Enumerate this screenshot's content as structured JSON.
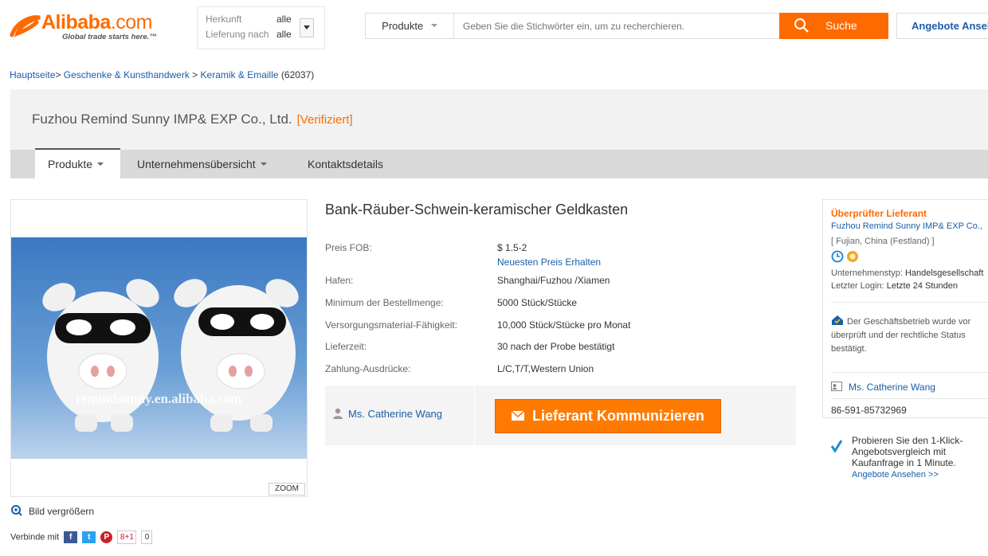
{
  "header": {
    "logo_brand": "Alibaba",
    "logo_suffix": ".com",
    "logo_tagline": "Global trade starts here.™",
    "origin_label": "Herkunft",
    "origin_value": "alle",
    "delivery_label": "Lieferung nach",
    "delivery_value": "alle",
    "search_category": "Produkte",
    "search_placeholder": "Geben Sie die Stichwörter ein, um zu recherchieren.",
    "search_button": "Suche",
    "offers_button": "Angebote Ansehen"
  },
  "breadcrumb": {
    "home": "Hauptseite",
    "sep": ">",
    "cat1": "Geschenke & Kunsthandwerk",
    "cat2": "Keramik & Emaille",
    "count": "(62037)"
  },
  "company": {
    "name": "Fuzhou Remind Sunny IMP& EXP Co., Ltd.",
    "verified": "[Verifiziert]"
  },
  "tabs": [
    {
      "label": "Produkte"
    },
    {
      "label": "Unternehmensübersicht"
    },
    {
      "label": "Kontaktsdetails"
    }
  ],
  "gallery": {
    "watermark": "remindsunny.en.alibaba.com",
    "zoom": "ZOOM",
    "enlarge": "Bild vergrößern",
    "share_label": "Verbinde mit",
    "gplus": "8+1",
    "share_count": "0"
  },
  "product": {
    "title": "Bank-Räuber-Schwein-keramischer Geldkasten",
    "price_label": "Preis FOB:",
    "price_value": "$ 1.5-2",
    "price_link": "Neuesten Preis Erhalten",
    "port_label": "Hafen:",
    "port_value": "Shanghai/Fuzhou /Xiamen",
    "moq_label": "Minimum der Bestellmenge:",
    "moq_value": "5000 Stück/Stücke",
    "supply_label": "Versorgungsmaterial-Fähigkeit:",
    "supply_value": "10,000 Stück/Stücke pro Monat",
    "lead_label": "Lieferzeit:",
    "lead_value": "30 nach der Probe bestätigt",
    "pay_label": "Zahlung-Ausdrücke:",
    "pay_value": "L/C,T/T,Western Union",
    "contact_person": "Ms. Catherine Wang",
    "contact_button": "Lieferant Kommunizieren"
  },
  "supplier_panel": {
    "title": "Überprüfter Lieferant",
    "company": "Fuzhou Remind Sunny IMP& EXP Co.,",
    "location": "[ Fujian, China (Festland) ]",
    "type_label": "Unternehmenstyp:",
    "type_value": "Handelsgesellschaft",
    "login_label": "Letzter Login:",
    "login_value": "Letzte 24 Stunden",
    "verify_line1": "Der Geschäftsbetrieb wurde vor",
    "verify_line2": "überprüft und der rechtliche Status",
    "verify_line3": "bestätigt.",
    "contact_name": "Ms. Catherine Wang",
    "phone": "86-591-85732969"
  },
  "promo": {
    "line1": "Probieren Sie den 1-Klick-",
    "line2": "Angebotsvergleich mit",
    "line3": "Kaufanfrage in 1 Minute.",
    "link": "Angebote Ansehen >>"
  },
  "colors": {
    "accent": "#ff6a00",
    "link": "#1a5ea8",
    "band": "#f2f2f2",
    "tabbar": "#d9d9d9",
    "facebook": "#3b5998",
    "twitter": "#2aa3ef",
    "pinterest": "#cb2027"
  }
}
